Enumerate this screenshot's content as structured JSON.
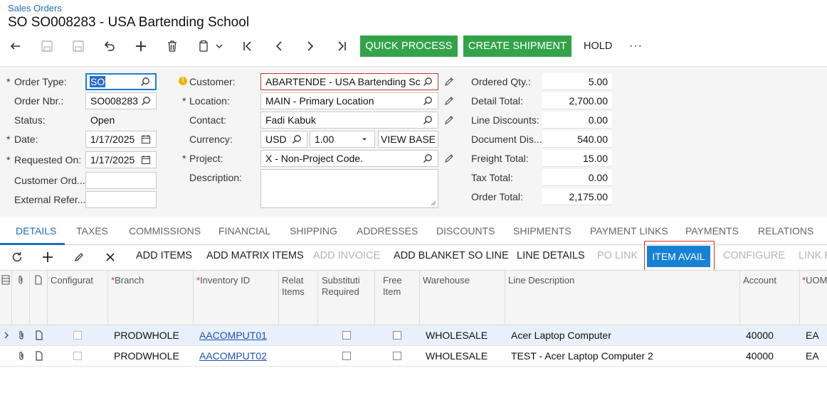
{
  "breadcrumb": "Sales Orders",
  "title": "SO SO008283 - USA Bartending School",
  "toolbar": {
    "quick_process": "QUICK PROCESS",
    "create_shipment": "CREATE SHIPMENT",
    "hold": "HOLD",
    "more": "···"
  },
  "form": {
    "order_type_label": "Order Type:",
    "order_type_value": "SO",
    "order_nbr_label": "Order Nbr.:",
    "order_nbr_value": "SO008283",
    "status_label": "Status:",
    "status_value": "Open",
    "date_label": "Date:",
    "date_value": "1/17/2025",
    "requested_on_label": "Requested On:",
    "requested_on_value": "1/17/2025",
    "customer_ord_label": "Customer Ord...",
    "customer_ord_value": "",
    "external_ref_label": "External Refer...",
    "external_ref_value": "",
    "customer_label": "Customer:",
    "customer_value": "ABARTENDE - USA Bartending School",
    "location_label": "Location:",
    "location_value": "MAIN - Primary Location",
    "contact_label": "Contact:",
    "contact_value": "Fadi Kabuk",
    "currency_label": "Currency:",
    "currency_value": "USD",
    "rate_value": "1.00",
    "view_base": "VIEW BASE",
    "project_label": "Project:",
    "project_value": "X - Non-Project Code.",
    "description_label": "Description:",
    "description_value": ""
  },
  "totals": [
    {
      "label": "Ordered Qty.:",
      "value": "5.00"
    },
    {
      "label": "Detail Total:",
      "value": "2,700.00"
    },
    {
      "label": "Line Discounts:",
      "value": "0.00"
    },
    {
      "label": "Document Dis...",
      "value": "540.00"
    },
    {
      "label": "Freight Total:",
      "value": "15.00"
    },
    {
      "label": "Tax Total:",
      "value": "0.00"
    },
    {
      "label": "Order Total:",
      "value": "2,175.00"
    }
  ],
  "tabs": [
    "DETAILS",
    "TAXES",
    "COMMISSIONS",
    "FINANCIAL",
    "SHIPPING",
    "ADDRESSES",
    "DISCOUNTS",
    "SHIPMENTS",
    "PAYMENT LINKS",
    "PAYMENTS",
    "RELATIONS"
  ],
  "grid_toolbar": {
    "add_items": "ADD ITEMS",
    "add_matrix_items": "ADD MATRIX ITEMS",
    "add_invoice": "ADD INVOICE",
    "add_blanket_so_line": "ADD BLANKET SO LINE",
    "line_details": "LINE DETAILS",
    "po_link": "PO LINK",
    "item_avail": "ITEM AVAIL",
    "configure": "CONFIGURE",
    "link_p": "LINK P"
  },
  "grid": {
    "headers": {
      "configurat": "Configurat",
      "branch": "Branch",
      "inventory_id": "Inventory ID",
      "related_items_1": "Relat",
      "related_items_2": "Items",
      "subst_1": "Substituti",
      "subst_2": "Required",
      "free_1": "Free",
      "free_2": "Item",
      "warehouse": "Warehouse",
      "line_description": "Line Description",
      "account": "Account",
      "uom": "UOM"
    },
    "rows": [
      {
        "branch": "PRODWHOLE",
        "inventory_id": "AACOMPUT01",
        "warehouse": "WHOLESALE",
        "description": "Acer Laptop Computer",
        "account": "40000",
        "uom": "EA"
      },
      {
        "branch": "PRODWHOLE",
        "inventory_id": "AACOMPUT02",
        "warehouse": "WHOLESALE",
        "description": "TEST - Acer Laptop Computer 2",
        "account": "40000",
        "uom": "EA"
      }
    ]
  },
  "colors": {
    "accent": "#1d6fb8",
    "green": "#33a34a",
    "button_blue": "#1781d6",
    "highlight": "#d9312b"
  }
}
